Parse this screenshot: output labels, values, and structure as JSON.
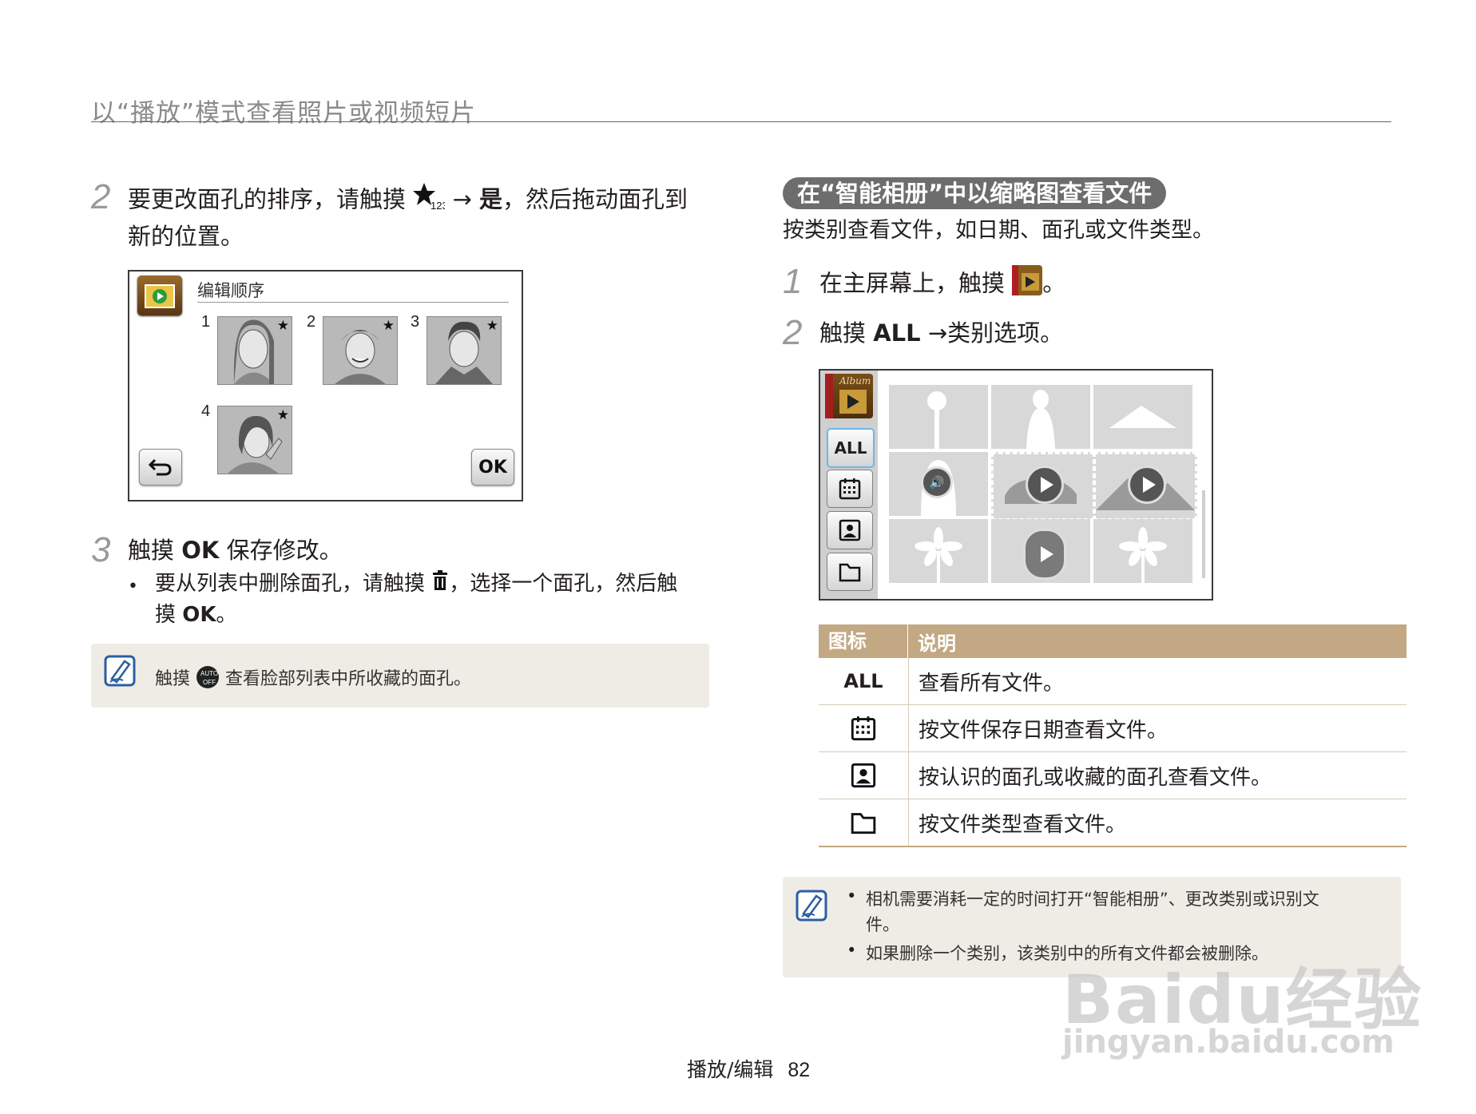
{
  "header": {
    "title": "以“播放”模式查看照片或视频短片"
  },
  "left": {
    "step2": {
      "num": "2",
      "text_before": "要更改面孔的排序，请触摸",
      "arrow": "→",
      "bold": "是",
      "text_after": "，然后拖动面孔到",
      "line2": "新的位置。"
    },
    "screen1": {
      "title": "编辑顺序",
      "thumb_nums": [
        "1",
        "2",
        "3",
        "4"
      ],
      "ok_label": "OK"
    },
    "step3": {
      "num": "3",
      "text_before": "触摸",
      "bold": "OK",
      "text_after": "保存修改。",
      "bullet_before": "要从列表中删除面孔，请触摸",
      "bullet_after": "，选择一个面孔，然后触",
      "bullet_line2_before": "摸",
      "bullet_line2_bold": "OK",
      "bullet_line2_after": "。"
    },
    "note": {
      "before": "触摸",
      "after": "查看脸部列表中所收藏的面孔。"
    }
  },
  "right": {
    "section_title": "在“智能相册”中以缩略图查看文件",
    "intro": "按类别查看文件，如日期、面孔或文件类型。",
    "step1": {
      "num": "1",
      "text": "在主屏幕上，触摸",
      "end": "。"
    },
    "step2": {
      "num": "2",
      "before": "触摸",
      "bold": "ALL",
      "after": "→类别选项。"
    },
    "screen2": {
      "all_label": "ALL",
      "album_label": "Album"
    },
    "legend": {
      "headers": [
        "图标",
        "说明"
      ],
      "rows": [
        {
          "icon": "ALL",
          "desc": "查看所有文件。"
        },
        {
          "icon": "calendar-icon",
          "desc": "按文件保存日期查看文件。"
        },
        {
          "icon": "face-icon",
          "desc": "按认识的面孔或收藏的面孔查看文件。"
        },
        {
          "icon": "folder-icon",
          "desc": "按文件类型查看文件。"
        }
      ]
    },
    "notes": [
      "相机需要消耗一定的时间打开“智能相册”、更改类别或识别文",
      "件。",
      "如果删除一个类别，该类别中的所有文件都会被删除。"
    ]
  },
  "footer": {
    "section": "播放/编辑",
    "page": "82"
  },
  "watermark": {
    "logo": "Baidu经验",
    "url": "jingyan.baidu.com"
  },
  "colors": {
    "table_header": "#c2a883",
    "note_bg": "#efece6",
    "pill_bg": "#6d6d6d",
    "step_num": "#9a9a9a"
  }
}
